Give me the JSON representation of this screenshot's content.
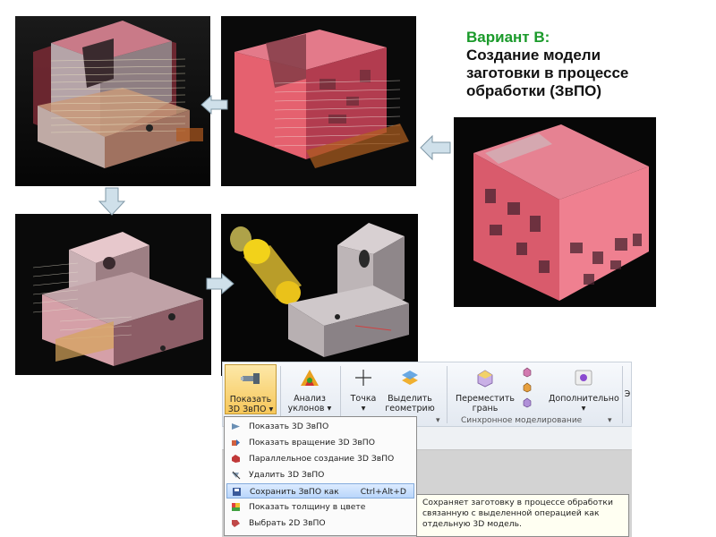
{
  "title": {
    "line1": "Вариант В:",
    "line2": "Создание модели",
    "line3": "заготовки в процессе",
    "line4": "обработки (ЗвПО)"
  },
  "ribbon": {
    "buttons": [
      {
        "line1": "Показать",
        "line2": "3D ЗвПО",
        "icon": "show-3d-ipw-icon"
      },
      {
        "line1": "Анализ",
        "line2": "уклонов",
        "icon": "draft-analysis-icon"
      },
      {
        "line1": "Точка",
        "line2": "",
        "icon": "point-icon"
      },
      {
        "line1": "Выделить",
        "line2": "геометрию",
        "icon": "extract-geometry-icon"
      },
      {
        "line1": "Переместить",
        "line2": "грань",
        "icon": "move-face-icon"
      },
      {
        "line1": "Дополнительно",
        "line2": "",
        "icon": "more-icon"
      },
      {
        "line1": "Э",
        "line2": "",
        "icon": ""
      }
    ],
    "group_label": "Синхронное моделирование"
  },
  "menu": {
    "items": [
      {
        "label": "Показать 3D ЗвПО",
        "shortcut": "",
        "icon": "show-ipw-icon"
      },
      {
        "label": "Показать вращение 3D ЗвПО",
        "shortcut": "",
        "icon": "rotate-ipw-icon"
      },
      {
        "label": "Параллельное создание 3D ЗвПО",
        "shortcut": "",
        "icon": "parallel-ipw-icon"
      },
      {
        "label": "Удалить 3D ЗвПО",
        "shortcut": "",
        "icon": "delete-ipw-icon"
      },
      {
        "label": "Сохранить ЗвПО как",
        "shortcut": "Ctrl+Alt+D",
        "icon": "save-ipw-icon"
      },
      {
        "label": "Показать толщину в цвете",
        "shortcut": "",
        "icon": "thickness-color-icon"
      },
      {
        "label": "Выбрать 2D ЗвПО",
        "shortcut": "",
        "icon": "select-2d-ipw-icon"
      }
    ],
    "highlighted_index": 4
  },
  "tooltip": {
    "line1": "Сохраняет заготовку в процессе обработки",
    "line2": "связанную с выделенной операцией как",
    "line3": "отдельную 3D модель."
  },
  "colors": {
    "title_accent": "#1a9a2a",
    "highlight": "#b9d6fb",
    "arrow": "#cfe0ea",
    "part_pink": "#e8707f",
    "part_gray": "#cfc9c9"
  }
}
